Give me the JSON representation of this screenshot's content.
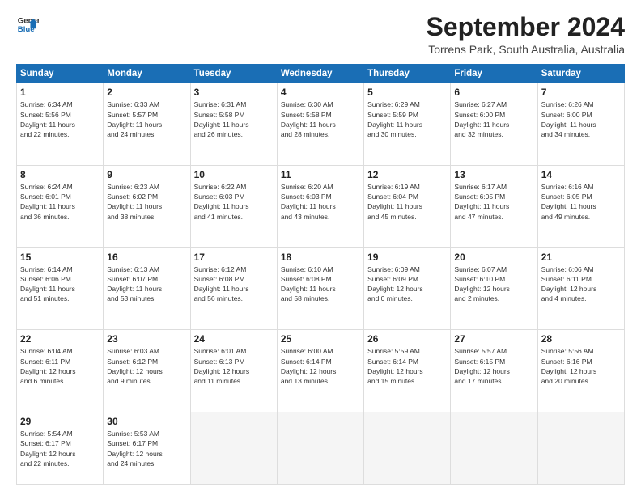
{
  "logo": {
    "line1": "General",
    "line2": "Blue"
  },
  "title": "September 2024",
  "location": "Torrens Park, South Australia, Australia",
  "days_of_week": [
    "Sunday",
    "Monday",
    "Tuesday",
    "Wednesday",
    "Thursday",
    "Friday",
    "Saturday"
  ],
  "weeks": [
    [
      {
        "day": "1",
        "info": "Sunrise: 6:34 AM\nSunset: 5:56 PM\nDaylight: 11 hours\nand 22 minutes."
      },
      {
        "day": "2",
        "info": "Sunrise: 6:33 AM\nSunset: 5:57 PM\nDaylight: 11 hours\nand 24 minutes."
      },
      {
        "day": "3",
        "info": "Sunrise: 6:31 AM\nSunset: 5:58 PM\nDaylight: 11 hours\nand 26 minutes."
      },
      {
        "day": "4",
        "info": "Sunrise: 6:30 AM\nSunset: 5:58 PM\nDaylight: 11 hours\nand 28 minutes."
      },
      {
        "day": "5",
        "info": "Sunrise: 6:29 AM\nSunset: 5:59 PM\nDaylight: 11 hours\nand 30 minutes."
      },
      {
        "day": "6",
        "info": "Sunrise: 6:27 AM\nSunset: 6:00 PM\nDaylight: 11 hours\nand 32 minutes."
      },
      {
        "day": "7",
        "info": "Sunrise: 6:26 AM\nSunset: 6:00 PM\nDaylight: 11 hours\nand 34 minutes."
      }
    ],
    [
      {
        "day": "8",
        "info": "Sunrise: 6:24 AM\nSunset: 6:01 PM\nDaylight: 11 hours\nand 36 minutes."
      },
      {
        "day": "9",
        "info": "Sunrise: 6:23 AM\nSunset: 6:02 PM\nDaylight: 11 hours\nand 38 minutes."
      },
      {
        "day": "10",
        "info": "Sunrise: 6:22 AM\nSunset: 6:03 PM\nDaylight: 11 hours\nand 41 minutes."
      },
      {
        "day": "11",
        "info": "Sunrise: 6:20 AM\nSunset: 6:03 PM\nDaylight: 11 hours\nand 43 minutes."
      },
      {
        "day": "12",
        "info": "Sunrise: 6:19 AM\nSunset: 6:04 PM\nDaylight: 11 hours\nand 45 minutes."
      },
      {
        "day": "13",
        "info": "Sunrise: 6:17 AM\nSunset: 6:05 PM\nDaylight: 11 hours\nand 47 minutes."
      },
      {
        "day": "14",
        "info": "Sunrise: 6:16 AM\nSunset: 6:05 PM\nDaylight: 11 hours\nand 49 minutes."
      }
    ],
    [
      {
        "day": "15",
        "info": "Sunrise: 6:14 AM\nSunset: 6:06 PM\nDaylight: 11 hours\nand 51 minutes."
      },
      {
        "day": "16",
        "info": "Sunrise: 6:13 AM\nSunset: 6:07 PM\nDaylight: 11 hours\nand 53 minutes."
      },
      {
        "day": "17",
        "info": "Sunrise: 6:12 AM\nSunset: 6:08 PM\nDaylight: 11 hours\nand 56 minutes."
      },
      {
        "day": "18",
        "info": "Sunrise: 6:10 AM\nSunset: 6:08 PM\nDaylight: 11 hours\nand 58 minutes."
      },
      {
        "day": "19",
        "info": "Sunrise: 6:09 AM\nSunset: 6:09 PM\nDaylight: 12 hours\nand 0 minutes."
      },
      {
        "day": "20",
        "info": "Sunrise: 6:07 AM\nSunset: 6:10 PM\nDaylight: 12 hours\nand 2 minutes."
      },
      {
        "day": "21",
        "info": "Sunrise: 6:06 AM\nSunset: 6:11 PM\nDaylight: 12 hours\nand 4 minutes."
      }
    ],
    [
      {
        "day": "22",
        "info": "Sunrise: 6:04 AM\nSunset: 6:11 PM\nDaylight: 12 hours\nand 6 minutes."
      },
      {
        "day": "23",
        "info": "Sunrise: 6:03 AM\nSunset: 6:12 PM\nDaylight: 12 hours\nand 9 minutes."
      },
      {
        "day": "24",
        "info": "Sunrise: 6:01 AM\nSunset: 6:13 PM\nDaylight: 12 hours\nand 11 minutes."
      },
      {
        "day": "25",
        "info": "Sunrise: 6:00 AM\nSunset: 6:14 PM\nDaylight: 12 hours\nand 13 minutes."
      },
      {
        "day": "26",
        "info": "Sunrise: 5:59 AM\nSunset: 6:14 PM\nDaylight: 12 hours\nand 15 minutes."
      },
      {
        "day": "27",
        "info": "Sunrise: 5:57 AM\nSunset: 6:15 PM\nDaylight: 12 hours\nand 17 minutes."
      },
      {
        "day": "28",
        "info": "Sunrise: 5:56 AM\nSunset: 6:16 PM\nDaylight: 12 hours\nand 20 minutes."
      }
    ],
    [
      {
        "day": "29",
        "info": "Sunrise: 5:54 AM\nSunset: 6:17 PM\nDaylight: 12 hours\nand 22 minutes."
      },
      {
        "day": "30",
        "info": "Sunrise: 5:53 AM\nSunset: 6:17 PM\nDaylight: 12 hours\nand 24 minutes."
      },
      {
        "day": "",
        "info": ""
      },
      {
        "day": "",
        "info": ""
      },
      {
        "day": "",
        "info": ""
      },
      {
        "day": "",
        "info": ""
      },
      {
        "day": "",
        "info": ""
      }
    ]
  ]
}
